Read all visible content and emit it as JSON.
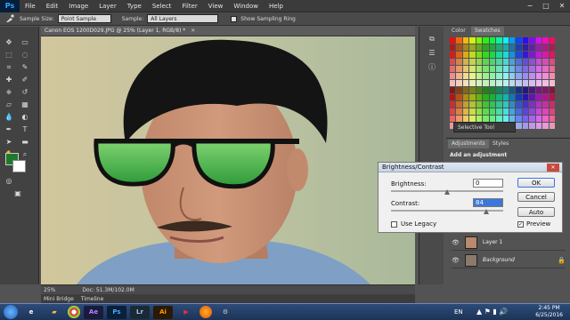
{
  "app": {
    "logo": "Ps"
  },
  "menu": [
    "File",
    "Edit",
    "Image",
    "Layer",
    "Type",
    "Select",
    "Filter",
    "View",
    "Window",
    "Help"
  ],
  "window_controls": {
    "minimize": "−",
    "maximize": "□",
    "close": "✕"
  },
  "options": {
    "sample_size_label": "Sample Size:",
    "sample_size_value": "Point Sample",
    "sample_label": "Sample:",
    "sample_value": "All Layers",
    "ring_label": "Show Sampling Ring"
  },
  "document": {
    "tab_title": "Canon EOS 1200D029.JPG @ 25% (Layer 1, RGB/8) *",
    "zoom": "25%",
    "doc_size": "Doc: 51.3M/102.0M"
  },
  "bottom_tabs": [
    "Mini Bridge",
    "Timeline"
  ],
  "panels": {
    "color_tab": "Color",
    "swatches_tab": "Swatches",
    "adjustments_tab": "Adjustments",
    "styles_tab": "Styles",
    "add_adjustment": "Add an adjustment",
    "selective_tool": "Selective Tool"
  },
  "layers": [
    {
      "name": "Layer 1"
    },
    {
      "name": "Background"
    }
  ],
  "dialog": {
    "title": "Brightness/Contrast",
    "brightness_label": "Brightness:",
    "brightness_value": "0",
    "contrast_label": "Contrast:",
    "contrast_value": "84",
    "legacy_label": "Use Legacy",
    "ok": "OK",
    "cancel": "Cancel",
    "auto": "Auto",
    "preview": "Preview"
  },
  "taskbar": {
    "apps": [
      "Ae",
      "Lr",
      "Ai"
    ],
    "lang": "EN",
    "time": "2:45 PM",
    "date": "6/25/2016"
  },
  "colors": {
    "foreground": "#1e7a2a",
    "background": "#ffffff",
    "ps_blue": "#31a8ff"
  }
}
